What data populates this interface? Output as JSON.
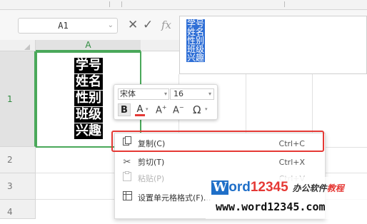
{
  "name_box": {
    "value": "A1"
  },
  "formula_bar": {
    "fx_label": "fx",
    "lines": [
      "学号",
      "姓名",
      "性别",
      "班级",
      "兴趣"
    ]
  },
  "column_headers": [
    "A"
  ],
  "row_headers": [
    "1",
    "2",
    "3",
    "4"
  ],
  "cell_A1": {
    "lines": [
      "学号",
      "姓名",
      "性别",
      "班级",
      "兴趣"
    ]
  },
  "mini_toolbar": {
    "font_name": "宋体",
    "font_size": "16",
    "bold_label": "B",
    "font_color_label": "A",
    "increase_font_label": "A",
    "decrease_font_label": "A",
    "special_char_label": "Ω"
  },
  "context_menu": {
    "items": [
      {
        "label": "复制(C)",
        "shortcut": "Ctrl+C",
        "icon": "copy-icon",
        "enabled": true
      },
      {
        "label": "剪切(T)",
        "shortcut": "Ctrl+X",
        "icon": "scissors-icon",
        "enabled": true
      },
      {
        "label": "粘贴(P)",
        "shortcut": "Ctrl+V",
        "icon": "paste-icon",
        "enabled": false
      },
      {
        "label": "设置单元格格式(F)...",
        "shortcut": "",
        "icon": "format-cells-icon",
        "enabled": true
      }
    ]
  },
  "watermark": {
    "brand_W": "W",
    "brand_ord": "ord",
    "brand_num": "12345",
    "tagline_a": "办公软件",
    "tagline_b": "教程",
    "url": "www.word12345.com"
  },
  "colors": {
    "selection_green": "#4aa85a",
    "highlight_red": "#e53935",
    "formula_highlight_blue": "#2f6fd6"
  }
}
